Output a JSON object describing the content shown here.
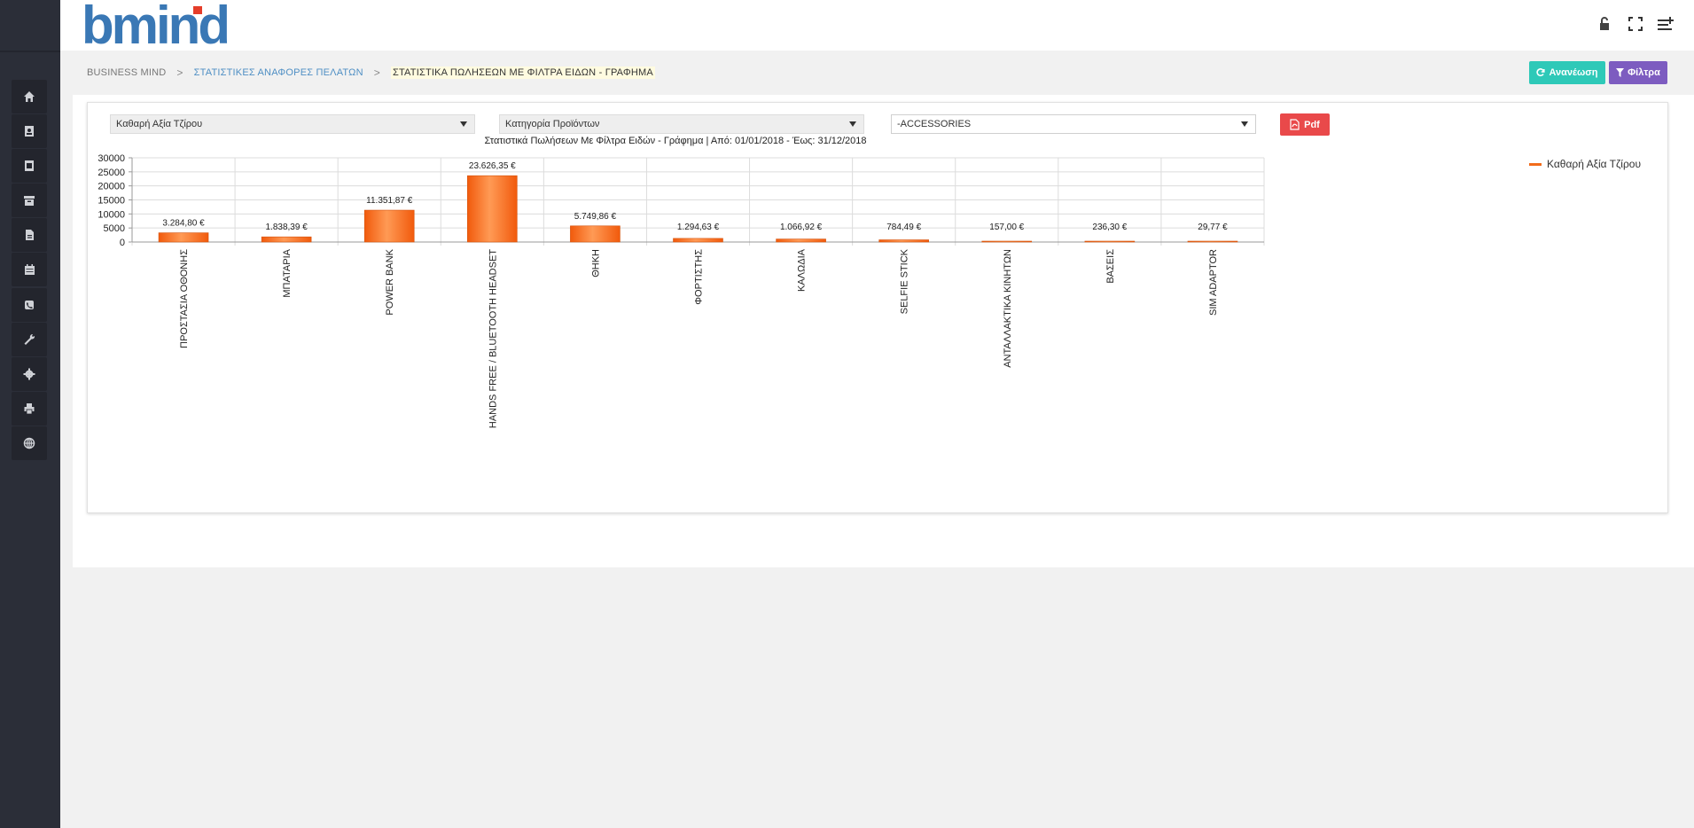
{
  "app": {
    "logo_text": "bmind",
    "brand_color": "#3a78b5",
    "accent_color": "#e53d2a"
  },
  "sidebar": {
    "items": [
      {
        "icon": "home-icon"
      },
      {
        "icon": "contacts-book-icon"
      },
      {
        "icon": "address-card-icon"
      },
      {
        "icon": "archive-icon"
      },
      {
        "icon": "document-icon"
      },
      {
        "icon": "calendar-icon"
      },
      {
        "icon": "phone-icon"
      },
      {
        "icon": "wrench-icon"
      },
      {
        "icon": "gear-icon"
      },
      {
        "icon": "print-icon"
      },
      {
        "icon": "globe-icon"
      }
    ]
  },
  "topbar": {
    "icons": [
      "lock-open-icon",
      "fullscreen-icon",
      "add-list-icon"
    ]
  },
  "breadcrumb": {
    "home": "BUSINESS MIND",
    "parent": "ΣΤΑΤΙΣΤΙΚΕΣ ΑΝΑΦΟΡΕΣ ΠΕΛΑΤΩΝ",
    "current": "ΣΤΑΤΙΣΤΙΚΑ ΠΩΛΗΣΕΩΝ ΜΕ ΦΙΛΤΡΑ ΕΙΔΩΝ - ΓΡΑΦΗΜΑ",
    "separator": ">"
  },
  "actions": {
    "refresh_label": "Ανανέωση",
    "filters_label": "Φίλτρα",
    "refresh_color": "#2ec9b8",
    "filters_color": "#7d5cc0"
  },
  "filters": {
    "measure": "Καθαρή Αξία Τζίρου",
    "grouping": "Κατηγορία Προϊόντων",
    "category": "-ACCESSORIES",
    "pdf_label": "Pdf",
    "pdf_color": "#e9494a"
  },
  "chart_data": {
    "type": "bar",
    "title": "Στατιστικά Πωλήσεων Με Φίλτρα Ειδών - Γράφημα | Από: 01/01/2018 - Έως: 31/12/2018",
    "xlabel": "",
    "ylabel": "",
    "ylim": [
      0,
      30000
    ],
    "yticks": [
      "30000",
      "25000",
      "20000",
      "15000",
      "10000",
      "5000",
      "0"
    ],
    "grid": true,
    "legend_position": "top-right",
    "bar_color": "#f26b1a",
    "categories": [
      "ΠΡΟΣΤΑΣΙΑ ΟΘΟΝΗΣ",
      "ΜΠΑΤΑΡΙΑ",
      "POWER BANK",
      "HANDS FREE / BLUETOOTH HEADSET",
      "ΘΗΚΗ",
      "ΦΟΡΤΙΣΤΗΣ",
      "ΚΑΛΩΔΙΑ",
      "SELFIE STICK",
      "ΑΝΤΑΛΛΑΚΤΙΚΑ ΚΙΝΗΤΩΝ",
      "ΒΑΣΕΙΣ",
      "SIM ADAPTOR"
    ],
    "series": [
      {
        "name": "Καθαρή Αξία Τζίρου",
        "values": [
          3284.8,
          1838.39,
          11351.87,
          23626.35,
          5749.86,
          1294.63,
          1066.92,
          784.49,
          157.0,
          236.3,
          29.77
        ],
        "labels": [
          "3.284,80 €",
          "1.838,39 €",
          "11.351,87 €",
          "23.626,35 €",
          "5.749,86 €",
          "1.294,63 €",
          "1.066,92 €",
          "784,49 €",
          "157,00 €",
          "236,30 €",
          "29,77 €"
        ]
      }
    ]
  }
}
